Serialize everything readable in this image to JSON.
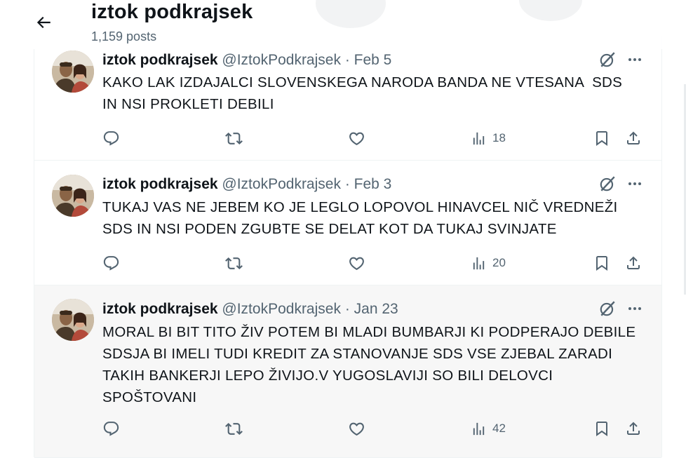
{
  "header": {
    "title": "iztok podkrajsek",
    "post_count": "1,159 posts"
  },
  "icons": {
    "back": "arrow-left-icon",
    "grok": "grok-icon",
    "more": "more-horizontal-icon",
    "reply": "reply-icon",
    "repost": "repost-icon",
    "like": "heart-icon",
    "views": "views-bar-chart-icon",
    "bookmark": "bookmark-icon",
    "share": "share-icon"
  },
  "colors": {
    "text": "#0f1419",
    "muted": "#536471",
    "hover_background": "#f7f7f7",
    "border": "#eff3f4"
  },
  "tweets": [
    {
      "author": "iztok podkrajsek",
      "handle": "@IztokPodkrajsek",
      "separator": "·",
      "date": "Feb 5",
      "text_lines": [
        "KAKO LAK IZDAJALCI SLOVENSKEGA NARODA BANDA NE VTESANA  SDS",
        "IN NSI PROKLETI DEBILI"
      ],
      "views": "18"
    },
    {
      "author": "iztok podkrajsek",
      "handle": "@IztokPodkrajsek",
      "separator": "·",
      "date": "Feb 3",
      "text_lines": [
        "TUKAJ VAS NE JEBEM KO JE LEGLO LOPOVOL HINAVCEL NIČ VREDNEŽI",
        "SDS IN NSI PODEN ZGUBTE SE DELAT KOT DA TUKAJ SVINJATE"
      ],
      "views": "20"
    },
    {
      "author": "iztok podkrajsek",
      "handle": "@IztokPodkrajsek",
      "separator": "·",
      "date": "Jan 23",
      "text_lines": [
        "MORAL BI BIT TITO ŽIV POTEM BI MLADI BUMBARJI KI PODPERAJO DEBILE",
        "SDSJA BI IMELI TUDI KREDIT ZA STANOVANJE SDS VSE ZJEBAL ZARADI",
        "TAKIH BANKERJI LEPO ŽIVIJO.V YUGOSLAVIJI SO BILI DELOVCI",
        "SPOŠTOVANI"
      ],
      "views": "42"
    }
  ]
}
